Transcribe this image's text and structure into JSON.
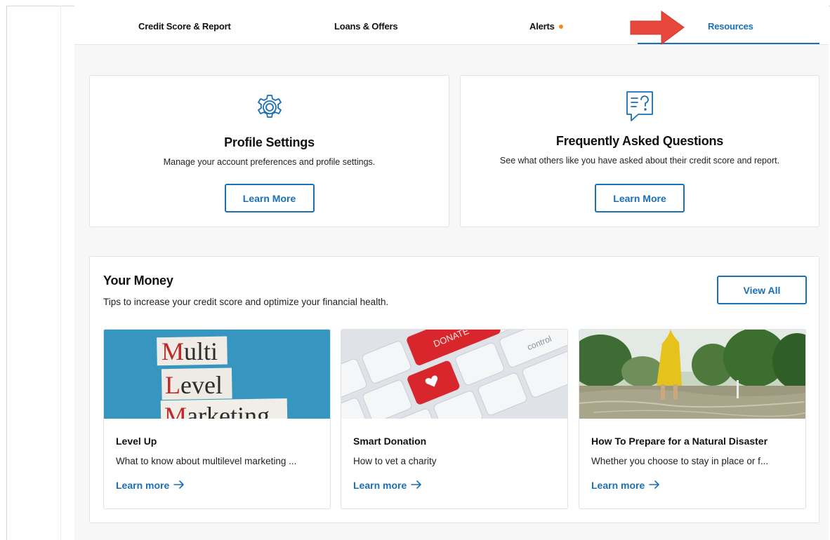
{
  "nav": {
    "tabs": [
      {
        "label": "Credit Score & Report"
      },
      {
        "label": "Loans & Offers"
      },
      {
        "label": "Alerts"
      },
      {
        "label": "Resources"
      }
    ],
    "active_tab": "Resources",
    "alert_dot_color": "#f28c18"
  },
  "cards": {
    "profile": {
      "icon": "gear-icon",
      "title": "Profile Settings",
      "description": "Manage your account preferences and profile settings.",
      "button": "Learn More"
    },
    "faq": {
      "icon": "faq-chat-icon",
      "title": "Frequently Asked Questions",
      "description": "See what others like you have asked about their credit score and report.",
      "button": "Learn More"
    }
  },
  "money": {
    "title": "Your Money",
    "subtitle": "Tips to increase your credit score and optimize your financial health.",
    "view_all": "View All",
    "articles": [
      {
        "image": "multi-level-marketing-image",
        "image_text": [
          "Multi",
          "Level",
          "Marketing"
        ],
        "title": "Level Up",
        "description": "What to know about multilevel marketing ...",
        "link": "Learn more"
      },
      {
        "image": "donate-keyboard-image",
        "image_text": [
          "DONATE",
          "control"
        ],
        "title": "Smart Donation",
        "description": "How to vet a charity",
        "link": "Learn more"
      },
      {
        "image": "flood-raincoat-image",
        "title": "How To Prepare for a Natural Disaster",
        "description": "Whether you choose to stay in place or f...",
        "link": "Learn more"
      }
    ]
  },
  "colors": {
    "accent": "#1a6fb5",
    "annotation_arrow": "#e8473c"
  }
}
